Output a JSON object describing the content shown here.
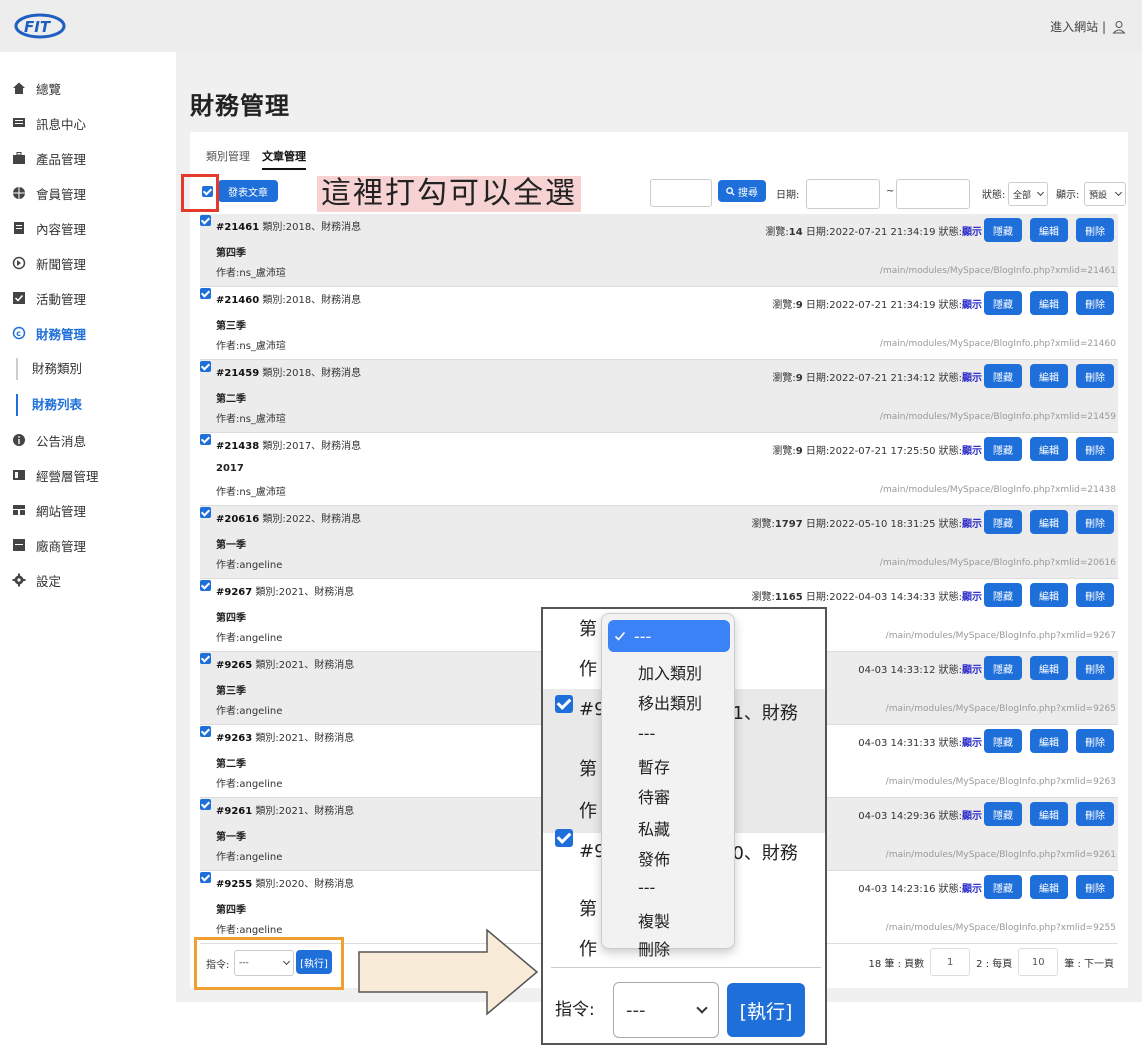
{
  "header": {
    "enter_site": "進入網站 |"
  },
  "sidebar": {
    "items": [
      {
        "label": "總覽",
        "icon": "home-icon"
      },
      {
        "label": "訊息中心",
        "icon": "message-icon"
      },
      {
        "label": "產品管理",
        "icon": "briefcase-icon"
      },
      {
        "label": "會員管理",
        "icon": "globe-icon"
      },
      {
        "label": "內容管理",
        "icon": "document-icon"
      },
      {
        "label": "新聞管理",
        "icon": "news-icon"
      },
      {
        "label": "活動管理",
        "icon": "checkbox-icon"
      },
      {
        "label": "財務管理",
        "icon": "copyright-icon"
      },
      {
        "label": "公告消息",
        "icon": "info-icon"
      },
      {
        "label": "經營層管理",
        "icon": "card-icon"
      },
      {
        "label": "網站管理",
        "icon": "table-icon"
      },
      {
        "label": "廠商管理",
        "icon": "cabinet-icon"
      },
      {
        "label": "設定",
        "icon": "gear-icon"
      }
    ],
    "subitems": [
      {
        "label": "財務類別"
      },
      {
        "label": "財務列表"
      }
    ]
  },
  "page": {
    "title": "財務管理",
    "tabs": [
      {
        "label": "類別管理"
      },
      {
        "label": "文章管理"
      }
    ]
  },
  "toolbar": {
    "add_button": "發表文章",
    "search_button": "搜尋",
    "date_label": "日期:",
    "date_sep": "~",
    "status_label": "狀態:",
    "status_value": "全部",
    "display_label": "顯示:",
    "display_value": "預設"
  },
  "annotation": {
    "text": "這裡打勾可以全選"
  },
  "articles": [
    {
      "id": "#21461",
      "category": "類別:2018、財務消息",
      "title": "第四季",
      "author": "作者:ns_盧沛瑄",
      "views_label": "瀏覽:",
      "views": "14",
      "date": "日期:2022-07-21 21:34:19",
      "status_label": "狀態:",
      "status": "顯示",
      "url": "/main/modules/MySpace/BlogInfo.php?xmlid=21461"
    },
    {
      "id": "#21460",
      "category": "類別:2018、財務消息",
      "title": "第三季",
      "author": "作者:ns_盧沛瑄",
      "views_label": "瀏覽:",
      "views": "9",
      "date": "日期:2022-07-21 21:34:19",
      "status_label": "狀態:",
      "status": "顯示",
      "url": "/main/modules/MySpace/BlogInfo.php?xmlid=21460"
    },
    {
      "id": "#21459",
      "category": "類別:2018、財務消息",
      "title": "第二季",
      "author": "作者:ns_盧沛瑄",
      "views_label": "瀏覽:",
      "views": "9",
      "date": "日期:2022-07-21 21:34:12",
      "status_label": "狀態:",
      "status": "顯示",
      "url": "/main/modules/MySpace/BlogInfo.php?xmlid=21459"
    },
    {
      "id": "#21438",
      "category": "類別:2017、財務消息",
      "title": "2017",
      "author": "作者:ns_盧沛瑄",
      "views_label": "瀏覽:",
      "views": "9",
      "date": "日期:2022-07-21 17:25:50",
      "status_label": "狀態:",
      "status": "顯示",
      "url": "/main/modules/MySpace/BlogInfo.php?xmlid=21438"
    },
    {
      "id": "#20616",
      "category": "類別:2022、財務消息",
      "title": "第一季",
      "author": "作者:angeline",
      "views_label": "瀏覽:",
      "views": "1797",
      "date": "日期:2022-05-10 18:31:25",
      "status_label": "狀態:",
      "status": "顯示",
      "url": "/main/modules/MySpace/BlogInfo.php?xmlid=20616"
    },
    {
      "id": "#9267",
      "category": "類別:2021、財務消息",
      "title": "第四季",
      "author": "作者:angeline",
      "views_label": "瀏覽:",
      "views": "1165",
      "date": "日期:2022-04-03 14:34:33",
      "status_label": "狀態:",
      "status": "顯示",
      "url": "/main/modules/MySpace/BlogInfo.php?xmlid=9267"
    },
    {
      "id": "#9265",
      "category": "類別:2021、財務消息",
      "title": "第三季",
      "author": "作者:angeline",
      "views_label": "",
      "views": "",
      "date": "04-03 14:33:12",
      "status_label": "狀態:",
      "status": "顯示",
      "url": "/main/modules/MySpace/BlogInfo.php?xmlid=9265"
    },
    {
      "id": "#9263",
      "category": "類別:2021、財務消息",
      "title": "第二季",
      "author": "作者:angeline",
      "views_label": "",
      "views": "",
      "date": "04-03 14:31:33",
      "status_label": "狀態:",
      "status": "顯示",
      "url": "/main/modules/MySpace/BlogInfo.php?xmlid=9263"
    },
    {
      "id": "#9261",
      "category": "類別:2021、財務消息",
      "title": "第一季",
      "author": "作者:angeline",
      "views_label": "",
      "views": "",
      "date": "04-03 14:29:36",
      "status_label": "狀態:",
      "status": "顯示",
      "url": "/main/modules/MySpace/BlogInfo.php?xmlid=9261"
    },
    {
      "id": "#9255",
      "category": "類別:2020、財務消息",
      "title": "第四季",
      "author": "作者:angeline",
      "views_label": "",
      "views": "",
      "date": "04-03 14:23:16",
      "status_label": "狀態:",
      "status": "顯示",
      "url": "/main/modules/MySpace/BlogInfo.php?xmlid=9255"
    }
  ],
  "row_buttons": {
    "hide": "隱藏",
    "edit": "編輯",
    "delete": "刪除"
  },
  "bottom": {
    "command_label": "指令:",
    "command_value": "---",
    "exec_button": "[執行]",
    "count_text": "18 筆 : 頁數",
    "page_value": "1",
    "per_page_text": "2 : 每頁",
    "per_page_value": "10",
    "next_text": "筆 : 下一頁"
  },
  "zoom": {
    "row_texts": [
      "第",
      "作",
      "#9",
      "21、財務",
      "第",
      "作",
      "#9",
      "20、財務",
      "第",
      "作"
    ],
    "command_label": "指令:",
    "command_value": "---",
    "exec_button": "[執行]",
    "options": [
      {
        "label": "---",
        "selected": true
      },
      {
        "label": "加入類別"
      },
      {
        "label": "移出類別"
      },
      {
        "label": "---"
      },
      {
        "label": "暫存"
      },
      {
        "label": "待審"
      },
      {
        "label": "私藏"
      },
      {
        "label": "發佈"
      },
      {
        "label": "---"
      },
      {
        "label": "複製"
      },
      {
        "label": "刪除"
      }
    ]
  },
  "colors": {
    "accent": "#1e6fd9",
    "highlight_red": "#e23b2e",
    "highlight_orange": "#f0a030",
    "annotation_bg": "#f6d2d2"
  }
}
